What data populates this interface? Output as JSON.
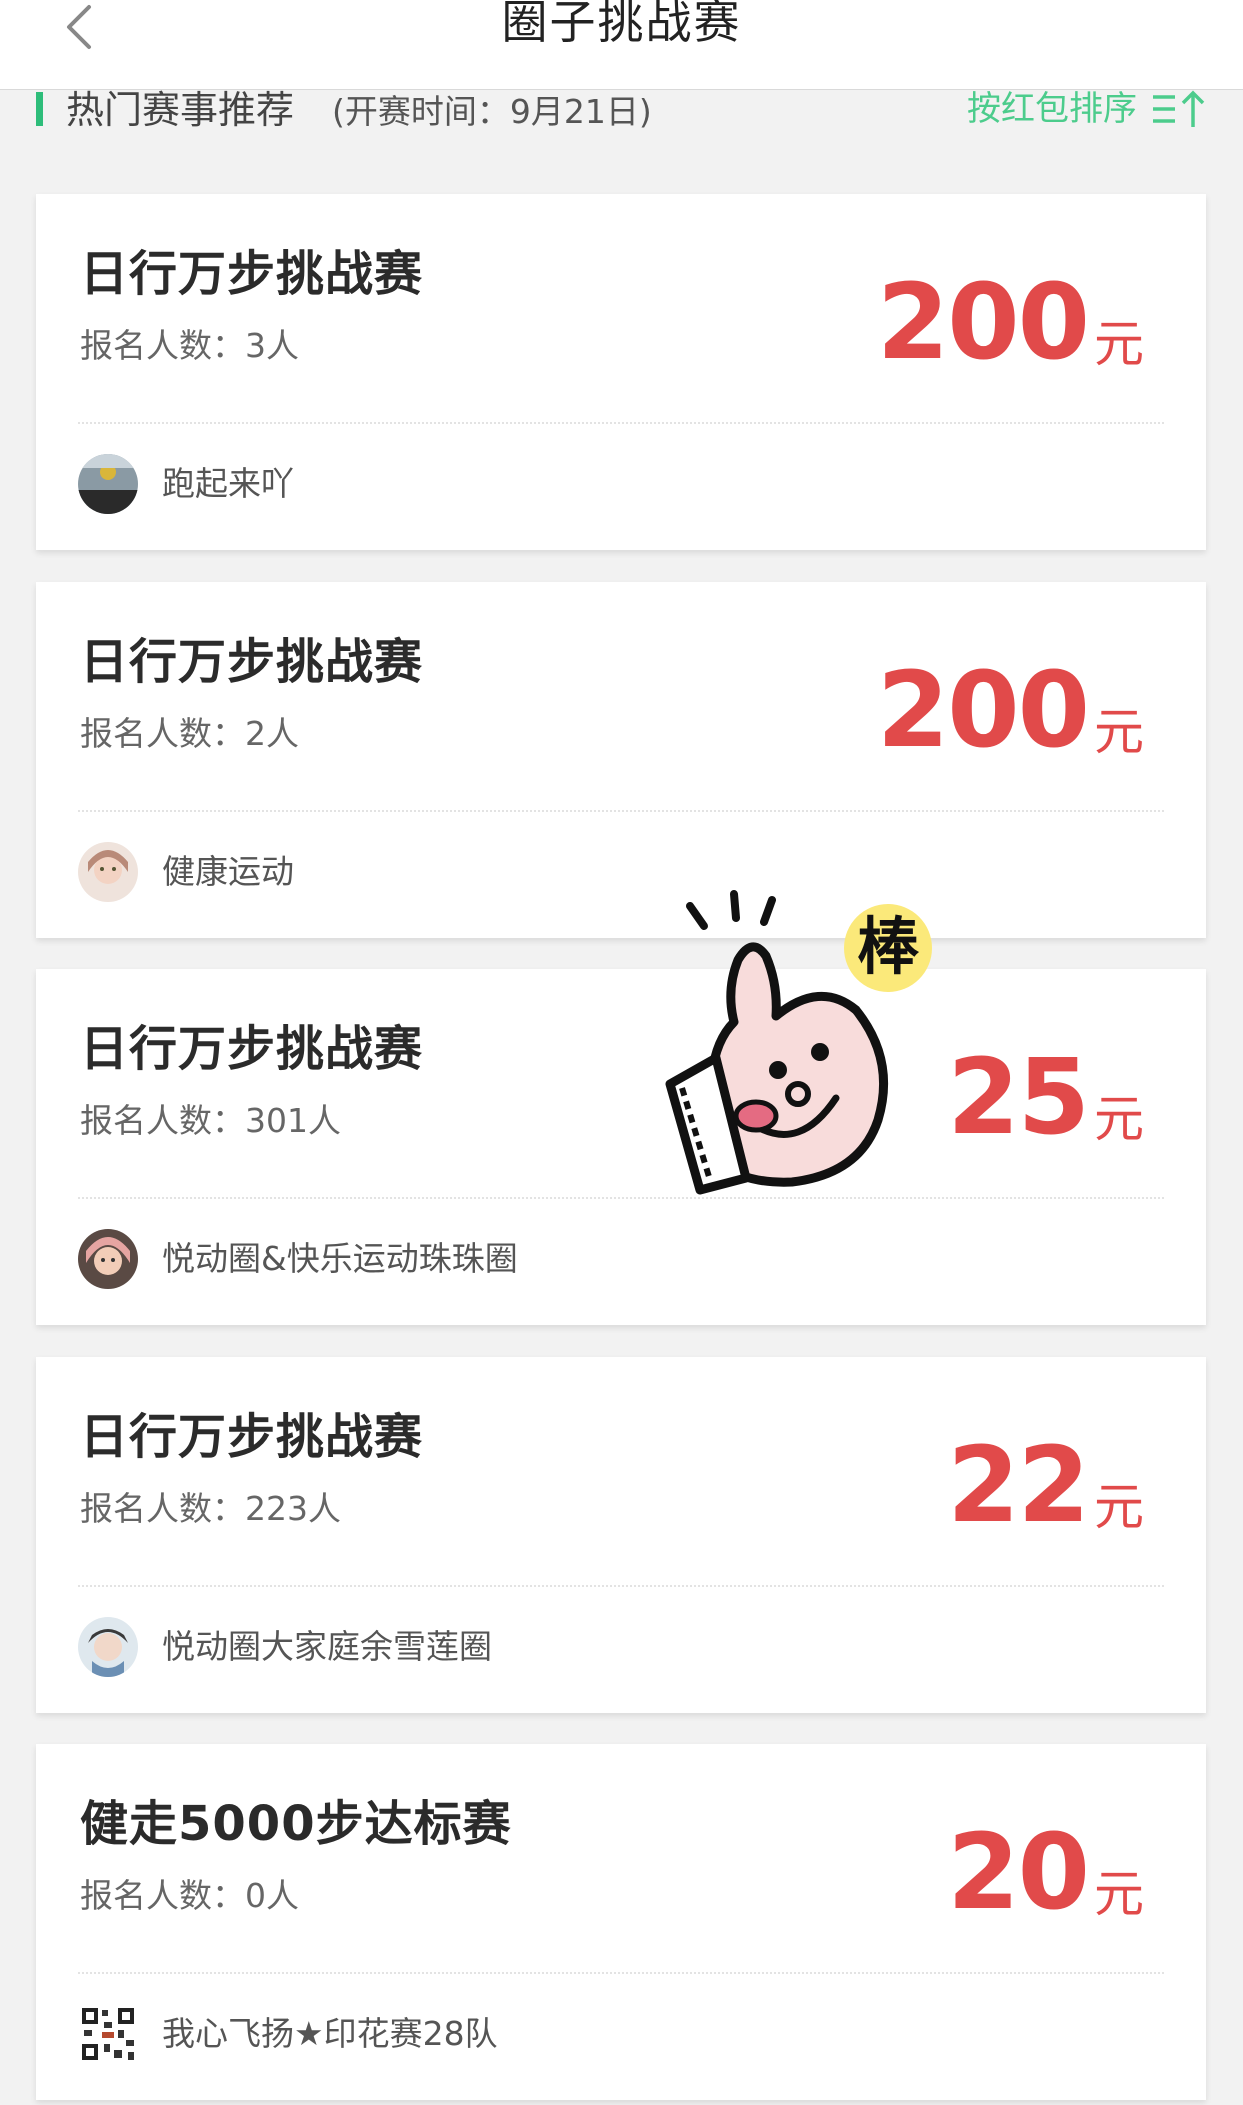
{
  "header": {
    "title": "圈子挑战赛"
  },
  "section": {
    "title": "热门赛事推荐",
    "subtitle": "(开赛时间：9月21日)",
    "sort_label": "按红包排序",
    "accent_color": "#2ebd7a"
  },
  "colors": {
    "prize": "#e14a4a",
    "sort": "#4ccc8c"
  },
  "cards": [
    {
      "title": "日行万步挑战赛",
      "signup": "报名人数：3人",
      "prize_amount": "200",
      "prize_unit": "元",
      "circle": "跑起来吖"
    },
    {
      "title": "日行万步挑战赛",
      "signup": "报名人数：2人",
      "prize_amount": "200",
      "prize_unit": "元",
      "circle": "健康运动"
    },
    {
      "title": "日行万步挑战赛",
      "signup": "报名人数：301人",
      "prize_amount": "25",
      "prize_unit": "元",
      "circle": "悦动圈&快乐运动珠珠圈"
    },
    {
      "title": "日行万步挑战赛",
      "signup": "报名人数：223人",
      "prize_amount": "22",
      "prize_unit": "元",
      "circle": "悦动圈大家庭余雪莲圈"
    },
    {
      "title": "健走5000步达标赛",
      "signup": "报名人数：0人",
      "prize_amount": "20",
      "prize_unit": "元",
      "circle": "我心飞扬★印花赛28队"
    }
  ],
  "sticker": {
    "text": "棒",
    "icon": "thumbs-up-sticker-icon"
  }
}
